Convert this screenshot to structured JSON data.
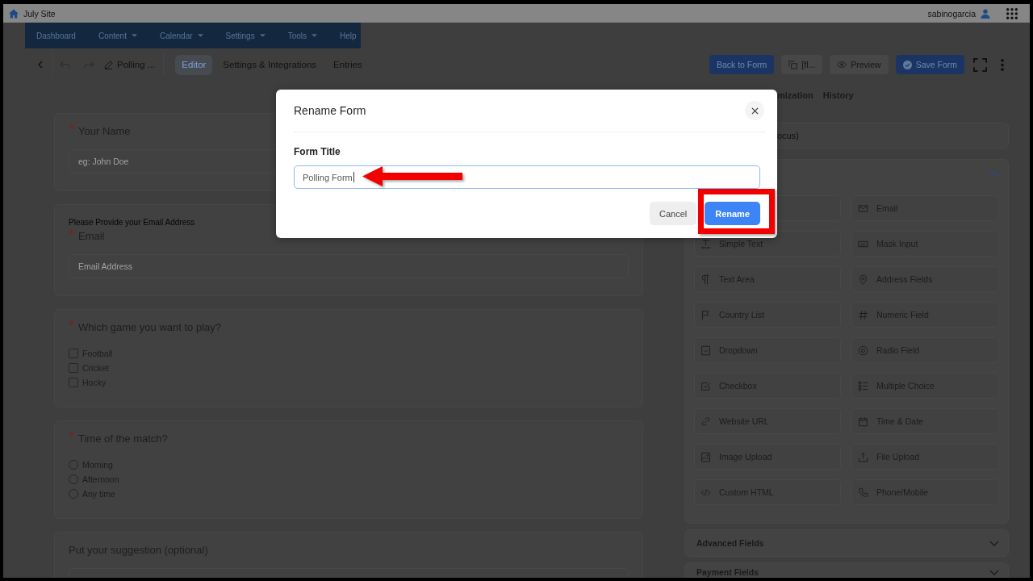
{
  "top_bar": {
    "site_name": "July Site",
    "username": "sabinogarcia"
  },
  "nav_menu": [
    {
      "label": "Dashboard",
      "has_menu": false
    },
    {
      "label": "Content",
      "has_menu": true
    },
    {
      "label": "Calendar",
      "has_menu": true
    },
    {
      "label": "Settings",
      "has_menu": true
    },
    {
      "label": "Tools",
      "has_menu": true
    },
    {
      "label": "Help",
      "has_menu": false
    }
  ],
  "toolbar": {
    "form_name": "Polling ...",
    "tabs": [
      {
        "label": "Editor",
        "selected": true
      },
      {
        "label": "Settings & Integrations",
        "selected": false
      },
      {
        "label": "Entries",
        "selected": false
      }
    ],
    "buttons": [
      {
        "label": "Back to Form",
        "kind": "primary"
      },
      {
        "label": "[fl...",
        "kind": "shortcode"
      },
      {
        "label": "Preview",
        "kind": "preview"
      },
      {
        "label": "Save Form",
        "kind": "save"
      }
    ]
  },
  "form_fields": [
    {
      "kind": "text",
      "label": "Your Name",
      "required": true,
      "placeholder": "eg: John Doe"
    },
    {
      "kind": "text",
      "help_text": "Please Provide your Email Address",
      "label": "Email",
      "required": true,
      "placeholder": "Email Address"
    },
    {
      "kind": "checkbox",
      "label": "Which game you want to play?",
      "required": true,
      "options": [
        {
          "label": "Football",
          "checked": false
        },
        {
          "label": "Cricket",
          "checked": false
        },
        {
          "label": "Hocky",
          "checked": false
        }
      ]
    },
    {
      "kind": "radio",
      "label": "Time of the match?",
      "required": true,
      "options": [
        {
          "label": "Morning",
          "selected": false
        },
        {
          "label": "Afternoon",
          "selected": false
        },
        {
          "label": "Any time",
          "selected": false
        }
      ]
    },
    {
      "kind": "textarea",
      "label": "Put your suggestion (optional)",
      "required": false
    }
  ],
  "side_panel": {
    "tabs": [
      {
        "label": "mization",
        "selected": false
      },
      {
        "label": "History",
        "selected": false
      }
    ],
    "search": {
      "placeholder": "ocus)"
    },
    "sections": [
      {
        "expanded": true,
        "items": [
          {
            "kind": "covered"
          },
          {
            "kind": "email",
            "label": "Email"
          },
          {
            "kind": "simple_text",
            "label": "Simple Text"
          },
          {
            "kind": "mask_input",
            "label": "Mask Input"
          },
          {
            "kind": "text_area",
            "label": "Text Area"
          },
          {
            "kind": "address",
            "label": "Address Fields"
          },
          {
            "kind": "country",
            "label": "Country List"
          },
          {
            "kind": "numeric",
            "label": "Numeric Field"
          },
          {
            "kind": "dropdown",
            "label": "Dropdown"
          },
          {
            "kind": "radio",
            "label": "Radio Field"
          },
          {
            "kind": "checkbox",
            "label": "Checkbox"
          },
          {
            "kind": "multiple_choice",
            "label": "Multiple Choice"
          },
          {
            "kind": "website_url",
            "label": "Website URL"
          },
          {
            "kind": "date",
            "label": "Time & Date"
          },
          {
            "kind": "image_upload",
            "label": "Image Upload"
          },
          {
            "kind": "file_upload",
            "label": "File Upload"
          },
          {
            "kind": "html",
            "label": "Custom HTML"
          },
          {
            "kind": "phone",
            "label": "Phone/Mobile"
          }
        ]
      },
      {
        "title": "Advanced Fields",
        "expanded": false
      },
      {
        "title": "Payment Fields",
        "expanded": false
      }
    ]
  },
  "dialog": {
    "title": "Rename Form",
    "field_label": "Form Title",
    "value": "Polling Form",
    "buttons": [
      {
        "label": "Cancel",
        "kind": "secondary"
      },
      {
        "label": "Rename",
        "kind": "primary"
      }
    ]
  }
}
